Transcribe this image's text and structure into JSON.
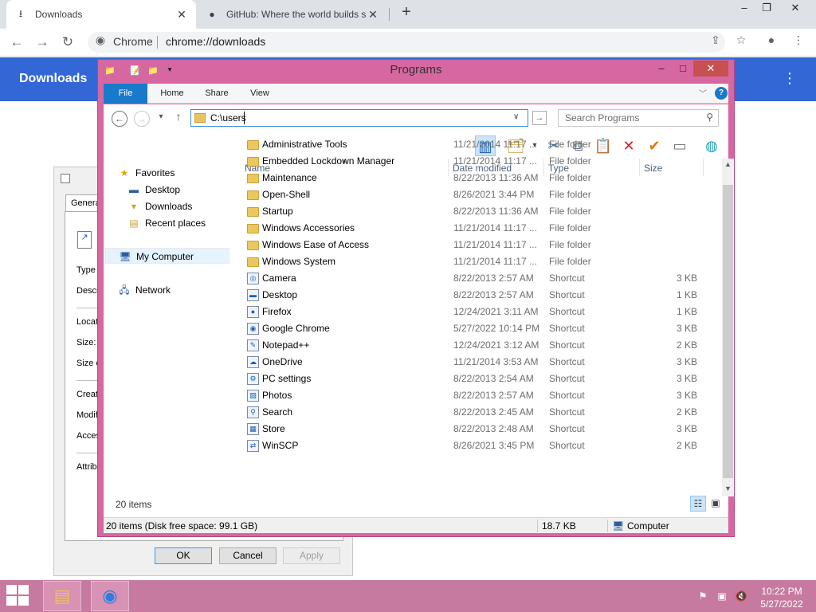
{
  "browser": {
    "tabs": [
      {
        "title": "Downloads",
        "icon": "download-icon"
      },
      {
        "title": "GitHub: Where the world builds s",
        "icon": "github-icon"
      }
    ],
    "omnibox": {
      "site": "Chrome",
      "url": "chrome://downloads"
    },
    "page_header": "Downloads",
    "header_color": "#3367d6"
  },
  "properties_dialog": {
    "tab": "General",
    "labels": [
      "Type",
      "Descr",
      "Locati",
      "Size:",
      "Size o",
      "Create",
      "Modif",
      "Acces",
      "Attribu"
    ],
    "ok": "OK",
    "cancel": "Cancel",
    "apply": "Apply"
  },
  "explorer": {
    "title": "Programs",
    "frame_color": "#d767a0",
    "ribbon_tabs": [
      "File",
      "Home",
      "Share",
      "View"
    ],
    "address": "C:\\users",
    "search_placeholder": "Search Programs",
    "nav": {
      "favorites": "Favorites",
      "favorites_items": [
        "Desktop",
        "Downloads",
        "Recent places"
      ],
      "my_computer": "My Computer",
      "network": "Network"
    },
    "columns": {
      "name": "Name",
      "date": "Date modified",
      "type": "Type",
      "size": "Size"
    },
    "files": [
      {
        "name": "Administrative Tools",
        "date": "11/21/2014 11:17 ...",
        "type": "File folder",
        "size": "",
        "icon": "folder-icon"
      },
      {
        "name": "Embedded Lockdown Manager",
        "date": "11/21/2014 11:17 ...",
        "type": "File folder",
        "size": "",
        "icon": "folder-icon"
      },
      {
        "name": "Maintenance",
        "date": "8/22/2013 11:36 AM",
        "type": "File folder",
        "size": "",
        "icon": "folder-icon"
      },
      {
        "name": "Open-Shell",
        "date": "8/26/2021 3:44 PM",
        "type": "File folder",
        "size": "",
        "icon": "folder-icon"
      },
      {
        "name": "Startup",
        "date": "8/22/2013 11:36 AM",
        "type": "File folder",
        "size": "",
        "icon": "folder-icon"
      },
      {
        "name": "Windows Accessories",
        "date": "11/21/2014 11:17 ...",
        "type": "File folder",
        "size": "",
        "icon": "folder-icon"
      },
      {
        "name": "Windows Ease of Access",
        "date": "11/21/2014 11:17 ...",
        "type": "File folder",
        "size": "",
        "icon": "folder-icon"
      },
      {
        "name": "Windows System",
        "date": "11/21/2014 11:17 ...",
        "type": "File folder",
        "size": "",
        "icon": "folder-icon"
      },
      {
        "name": "Camera",
        "date": "8/22/2013 2:57 AM",
        "type": "Shortcut",
        "size": "3 KB",
        "icon": "camera-shortcut-icon"
      },
      {
        "name": "Desktop",
        "date": "8/22/2013 2:57 AM",
        "type": "Shortcut",
        "size": "1 KB",
        "icon": "desktop-shortcut-icon"
      },
      {
        "name": "Firefox",
        "date": "12/24/2021 3:11 AM",
        "type": "Shortcut",
        "size": "1 KB",
        "icon": "firefox-shortcut-icon"
      },
      {
        "name": "Google Chrome",
        "date": "5/27/2022 10:14 PM",
        "type": "Shortcut",
        "size": "3 KB",
        "icon": "chrome-shortcut-icon"
      },
      {
        "name": "Notepad++",
        "date": "12/24/2021 3:12 AM",
        "type": "Shortcut",
        "size": "2 KB",
        "icon": "notepadpp-shortcut-icon"
      },
      {
        "name": "OneDrive",
        "date": "11/21/2014 3:53 AM",
        "type": "Shortcut",
        "size": "3 KB",
        "icon": "onedrive-shortcut-icon"
      },
      {
        "name": "PC settings",
        "date": "8/22/2013 2:54 AM",
        "type": "Shortcut",
        "size": "3 KB",
        "icon": "settings-shortcut-icon"
      },
      {
        "name": "Photos",
        "date": "8/22/2013 2:57 AM",
        "type": "Shortcut",
        "size": "3 KB",
        "icon": "photos-shortcut-icon"
      },
      {
        "name": "Search",
        "date": "8/22/2013 2:45 AM",
        "type": "Shortcut",
        "size": "2 KB",
        "icon": "search-shortcut-icon"
      },
      {
        "name": "Store",
        "date": "8/22/2013 2:48 AM",
        "type": "Shortcut",
        "size": "3 KB",
        "icon": "store-shortcut-icon"
      },
      {
        "name": "WinSCP",
        "date": "8/26/2021 3:45 PM",
        "type": "Shortcut",
        "size": "2 KB",
        "icon": "winscp-shortcut-icon"
      }
    ],
    "item_count": "20 items",
    "status": {
      "left": "20 items (Disk free space: 99.1 GB)",
      "size": "18.7 KB",
      "location": "Computer"
    }
  },
  "taskbar": {
    "time": "10:22 PM",
    "date": "5/27/2022",
    "color": "#c77a9f"
  }
}
